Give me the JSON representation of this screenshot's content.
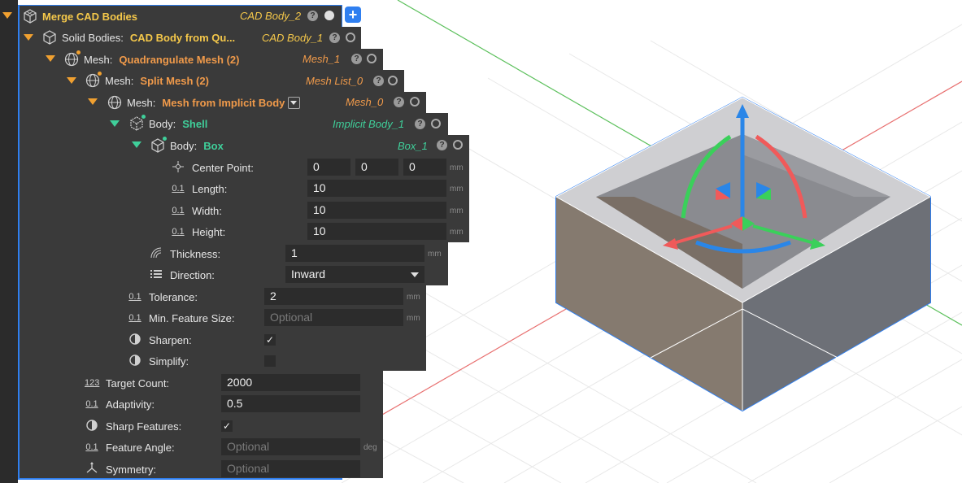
{
  "nodes": {
    "merge": {
      "name": "Merge CAD Bodies",
      "output": "CAD Body_2"
    },
    "solid": {
      "label": "Solid Bodies:",
      "name": "CAD Body from Qu...",
      "output": "CAD Body_1"
    },
    "quad": {
      "label": "Mesh:",
      "name": "Quadrangulate Mesh (2)",
      "output": "Mesh_1"
    },
    "split": {
      "label": "Mesh:",
      "name": "Split Mesh (2)",
      "output": "Mesh List_0"
    },
    "implicit": {
      "label": "Mesh:",
      "name": "Mesh from Implicit Body",
      "output": "Mesh_0"
    },
    "shell": {
      "label": "Body:",
      "name": "Shell",
      "output": "Implicit Body_1"
    },
    "box": {
      "label": "Body:",
      "name": "Box",
      "output": "Box_1"
    }
  },
  "help_glyph": "?",
  "add_glyph": "+",
  "box_props": {
    "center": {
      "label": "Center Point:",
      "x": "0",
      "y": "0",
      "z": "0",
      "unit": "mm"
    },
    "length": {
      "label": "Length:",
      "value": "10",
      "unit": "mm"
    },
    "width": {
      "label": "Width:",
      "value": "10",
      "unit": "mm"
    },
    "height": {
      "label": "Height:",
      "value": "10",
      "unit": "mm"
    }
  },
  "shell_props": {
    "thickness": {
      "label": "Thickness:",
      "value": "1",
      "unit": "mm"
    },
    "direction": {
      "label": "Direction:",
      "value": "Inward"
    }
  },
  "implicit_props": {
    "tolerance": {
      "label": "Tolerance:",
      "value": "2",
      "unit": "mm"
    },
    "min_feature": {
      "label": "Min. Feature Size:",
      "placeholder": "Optional",
      "unit": "mm"
    },
    "sharpen": {
      "label": "Sharpen:",
      "checked": true,
      "glyph": "✓"
    },
    "simplify": {
      "label": "Simplify:",
      "checked": false
    }
  },
  "quad_props": {
    "target_count": {
      "label": "Target Count:",
      "value": "2000"
    },
    "adaptivity": {
      "label": "Adaptivity:",
      "value": "0.5"
    },
    "sharp_features": {
      "label": "Sharp Features:",
      "checked": true,
      "glyph": "✓"
    },
    "feature_angle": {
      "label": "Feature Angle:",
      "placeholder": "Optional",
      "unit": "deg"
    },
    "symmetry": {
      "label": "Symmetry:",
      "placeholder": "Optional"
    }
  },
  "icon_glyphs": {
    "num": "0.1",
    "int": "123"
  },
  "colors": {
    "panel_bg": "#3a3a3a",
    "field_bg": "#2c2c2c",
    "orange": "#f09a4a",
    "yellow": "#f5c84a",
    "green": "#3fcf9a",
    "accent_blue": "#2f7ff0",
    "gizmo_blue": "#2a86e8",
    "gizmo_red": "#f05a5a",
    "gizmo_green": "#3ad05a"
  }
}
